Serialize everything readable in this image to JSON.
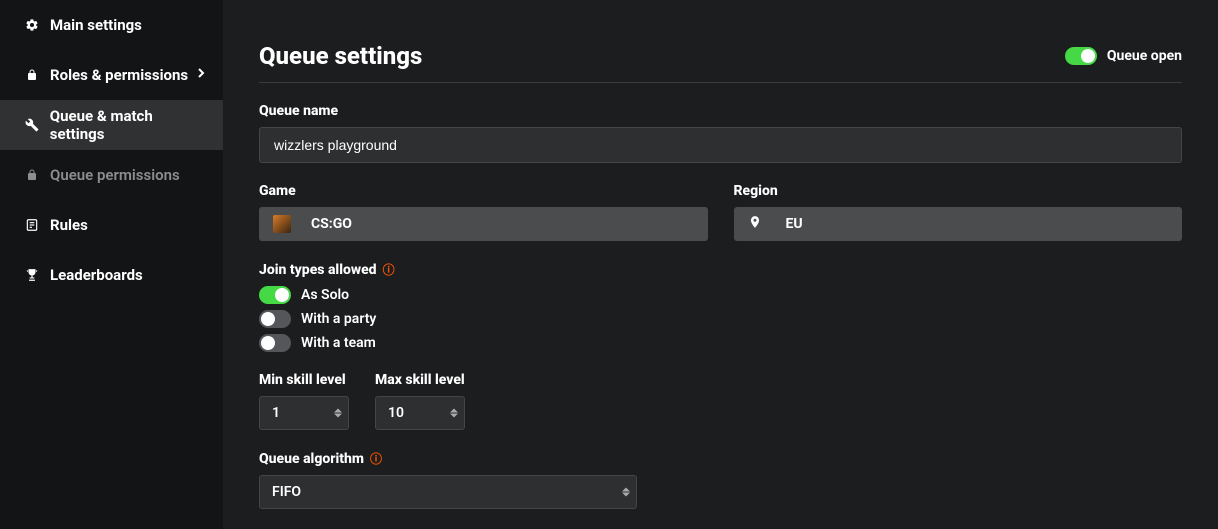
{
  "sidebar": {
    "items": [
      {
        "label": "Main settings",
        "icon": "gear-icon"
      },
      {
        "label": "Roles & permissions",
        "icon": "lock-icon",
        "chevron": true
      },
      {
        "label": "Queue & match settings",
        "icon": "tools-icon",
        "active": true
      },
      {
        "label": "Queue permissions",
        "icon": "lock-icon",
        "secondary": true
      },
      {
        "label": "Rules",
        "icon": "list-icon"
      },
      {
        "label": "Leaderboards",
        "icon": "trophy-icon"
      }
    ]
  },
  "header": {
    "title": "Queue settings",
    "toggle_label": "Queue open",
    "toggle_on": true
  },
  "form": {
    "queue_name": {
      "label": "Queue name",
      "value": "wizzlers playground"
    },
    "game": {
      "label": "Game",
      "value": "CS:GO"
    },
    "region": {
      "label": "Region",
      "value": "EU"
    },
    "join_types": {
      "label": "Join types allowed",
      "options": [
        {
          "label": "As Solo",
          "on": true
        },
        {
          "label": "With a party",
          "on": false
        },
        {
          "label": "With a team",
          "on": false
        }
      ]
    },
    "min_skill": {
      "label": "Min skill level",
      "value": "1"
    },
    "max_skill": {
      "label": "Max skill level",
      "value": "10"
    },
    "algorithm": {
      "label": "Queue algorithm",
      "value": "FIFO"
    }
  }
}
